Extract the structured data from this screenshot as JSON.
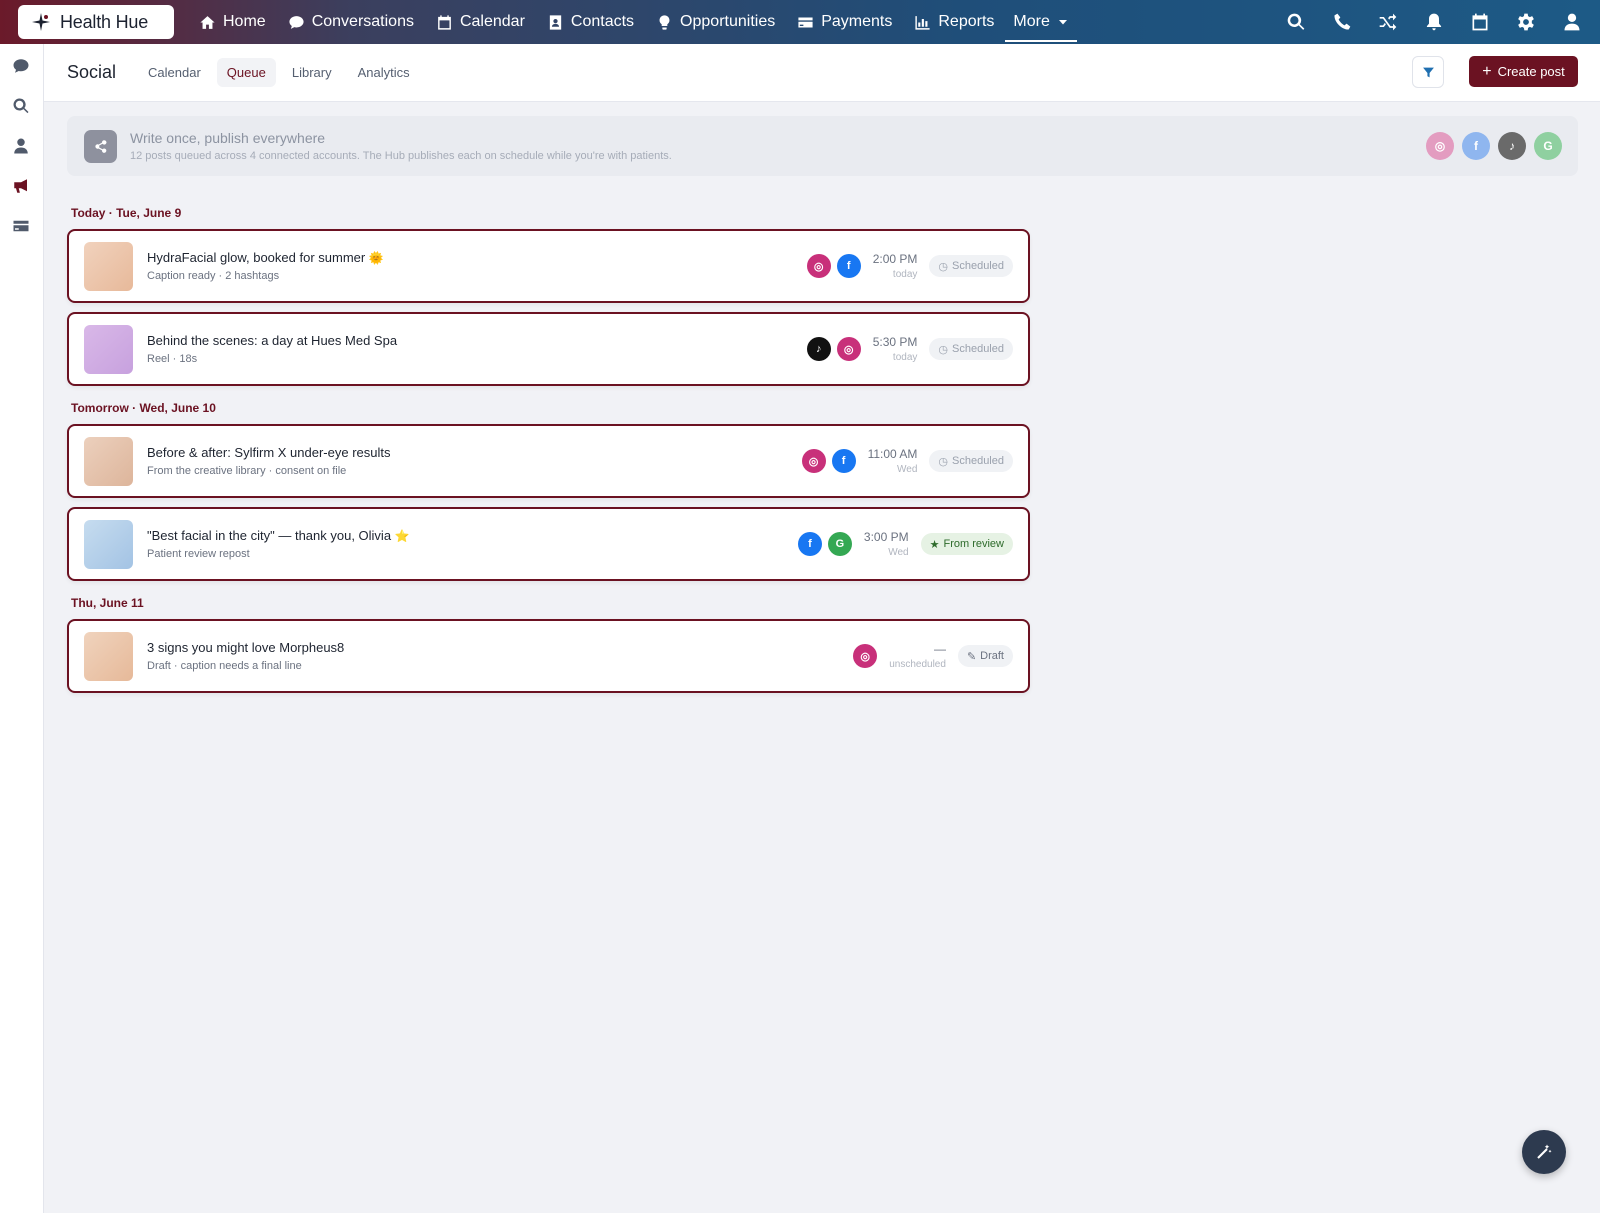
{
  "app": {
    "name": "Health Hue"
  },
  "nav": {
    "items": [
      {
        "label": "Home",
        "icon": "home-icon"
      },
      {
        "label": "Conversations",
        "icon": "chat-icon"
      },
      {
        "label": "Calendar",
        "icon": "calendar-icon"
      },
      {
        "label": "Contacts",
        "icon": "contacts-icon"
      },
      {
        "label": "Opportunities",
        "icon": "lightbulb-icon"
      },
      {
        "label": "Payments",
        "icon": "credit-card-icon"
      },
      {
        "label": "Reports",
        "icon": "bar-chart-icon"
      }
    ],
    "more_label": "More"
  },
  "header": {
    "title": "Social",
    "tabs": [
      "Calendar",
      "Queue",
      "Library",
      "Analytics"
    ],
    "active_tab": "Queue",
    "create_label": "Create post"
  },
  "banner": {
    "title": "Write once, publish everywhere",
    "subtitle": "12 posts queued across 4 connected accounts. The Hub publishes each on schedule while you're with patients.",
    "accounts": [
      "instagram",
      "facebook",
      "tiktok",
      "google"
    ]
  },
  "queue": {
    "groups": [
      {
        "label": "Today · Tue, June 9"
      },
      {
        "label": "Tomorrow · Wed, June 10"
      },
      {
        "label": "Thu, June 11"
      }
    ],
    "posts": [
      {
        "title": "HydraFacial glow, booked for summer",
        "emoji": "🌞",
        "subtitle": "Caption ready · 2 hashtags",
        "time": "2:00 PM",
        "when": "today",
        "status": "Scheduled",
        "networks": [
          "instagram",
          "facebook"
        ]
      },
      {
        "title": "Behind the scenes: a day at Hues Med Spa",
        "emoji": "",
        "subtitle": "Reel · 18s",
        "time": "5:30 PM",
        "when": "today",
        "status": "Scheduled",
        "networks": [
          "tiktok",
          "instagram"
        ]
      },
      {
        "title": "Before & after: Sylfirm X under-eye results",
        "emoji": "",
        "subtitle": "From the creative library · consent on file",
        "time": "11:00 AM",
        "when": "Wed",
        "status": "Scheduled",
        "networks": [
          "instagram",
          "facebook"
        ]
      },
      {
        "title": "\"Best facial in the city\" — thank you, Olivia",
        "emoji": "⭐",
        "subtitle": "Patient review repost",
        "time": "3:00 PM",
        "when": "Wed",
        "status": "From review",
        "networks": [
          "facebook",
          "google"
        ]
      },
      {
        "title": "3 signs you might love Morpheus8",
        "emoji": "",
        "subtitle": "Draft · caption needs a final line",
        "time": "—",
        "when": "unscheduled",
        "status": "Draft",
        "networks": [
          "instagram"
        ]
      }
    ]
  },
  "colors": {
    "accent": "#6b1222",
    "instagram": "#c8307a",
    "facebook": "#1877f2",
    "tiktok": "#111111",
    "google": "#34a853"
  }
}
